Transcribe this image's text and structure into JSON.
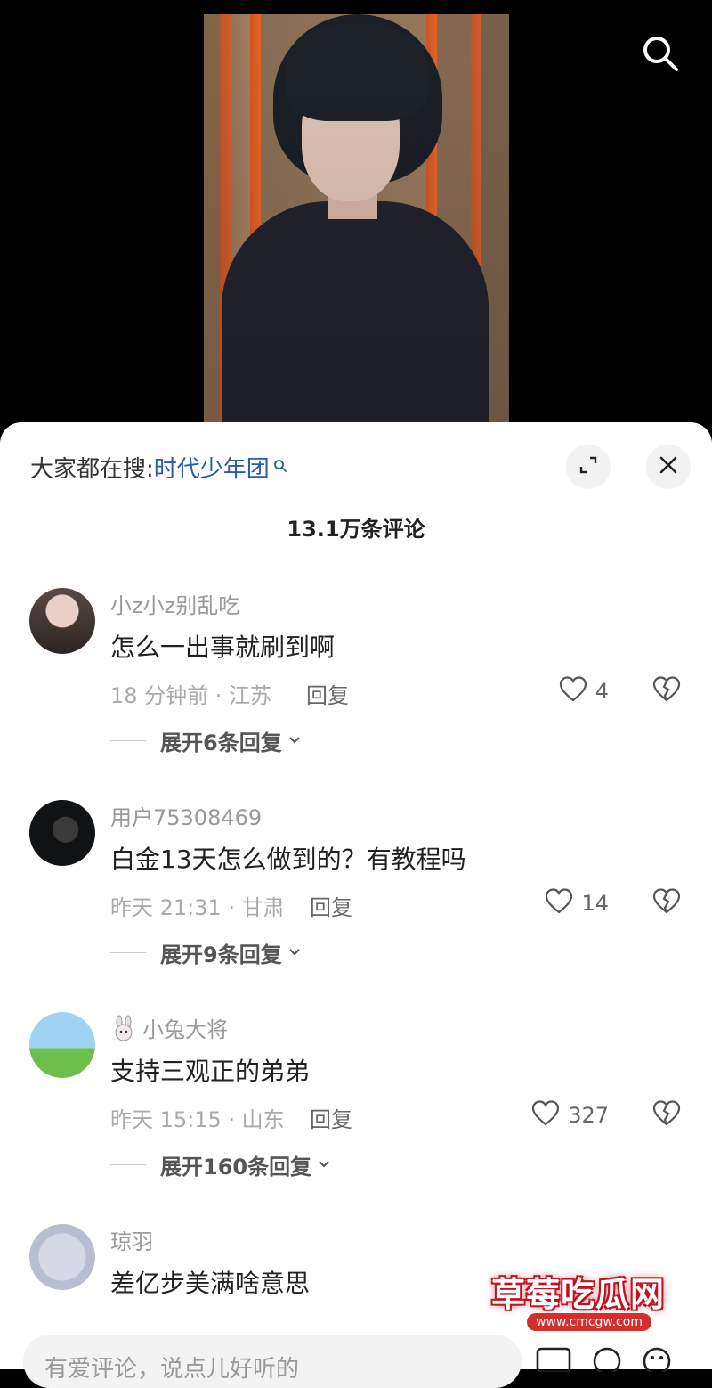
{
  "header": {
    "search_icon": "search-icon"
  },
  "sheet": {
    "trending_prefix": "大家都在搜:",
    "trending_keyword": "时代少年团",
    "comment_count": "13.1万条评论",
    "input_placeholder": "有爱评论，说点儿好听的"
  },
  "comments": [
    {
      "username": "小z小z别乱吃",
      "text": "怎么一出事就刷到啊",
      "meta": "18 分钟前 · 江苏",
      "reply": "回复",
      "likes": "4",
      "expand": "展开6条回复"
    },
    {
      "username": "用户75308469",
      "text": "白金13天怎么做到的？有教程吗",
      "meta": "昨天 21:31 · 甘肃",
      "reply": "回复",
      "likes": "14",
      "expand": "展开9条回复"
    },
    {
      "username": "小兔大将",
      "text": "支持三观正的弟弟",
      "meta": "昨天 15:15 · 山东",
      "reply": "回复",
      "likes": "327",
      "expand": "展开160条回复"
    },
    {
      "username": "琼羽",
      "text": "差亿步美满啥意思"
    }
  ],
  "watermark": {
    "text": "草莓吃瓜网",
    "url": "www.cmcgw.com"
  },
  "colors": {
    "keyword": "#2a5ca8",
    "watermark_red": "#c1121f"
  }
}
